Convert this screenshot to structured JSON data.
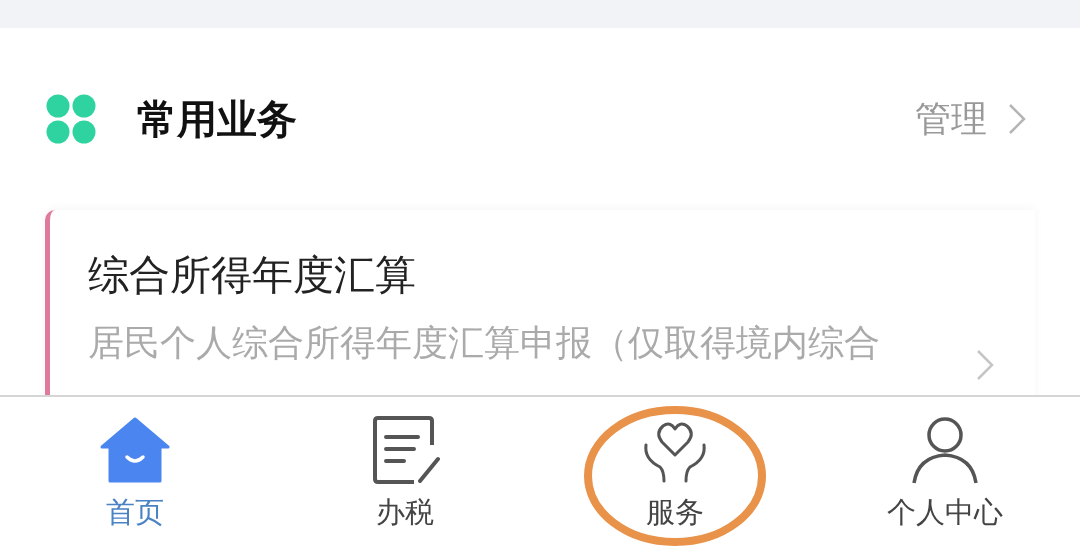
{
  "section": {
    "title": "常用业务",
    "action": "管理"
  },
  "items": [
    {
      "title": "综合所得年度汇算",
      "description": "居民个人综合所得年度汇算申报（仅取得境内综合"
    }
  ],
  "tabs": [
    {
      "label": "首页",
      "kind": "home",
      "selected": true,
      "circled": false
    },
    {
      "label": "办税",
      "kind": "document",
      "selected": false,
      "circled": false
    },
    {
      "label": "服务",
      "kind": "service",
      "selected": false,
      "circled": true
    },
    {
      "label": "个人中心",
      "kind": "person",
      "selected": false,
      "circled": false
    }
  ]
}
